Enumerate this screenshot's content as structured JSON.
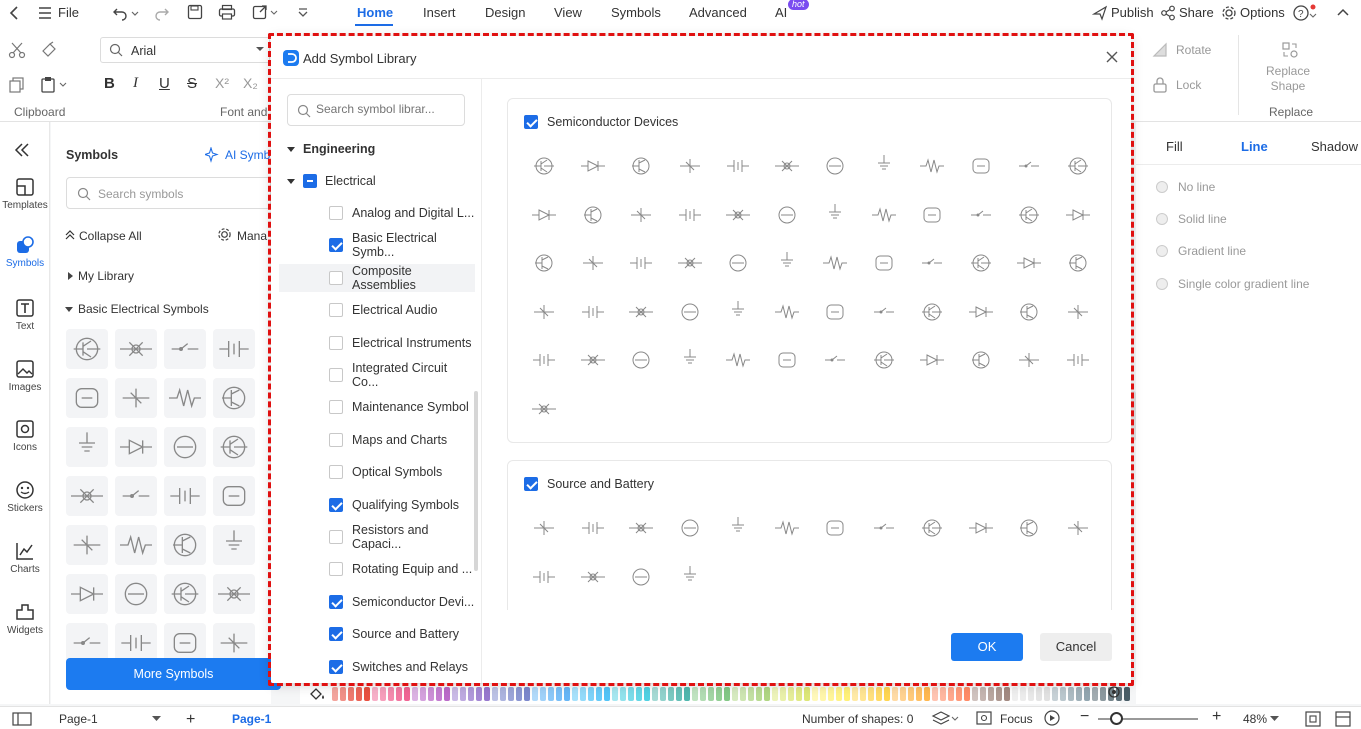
{
  "menubar": {
    "file": "File",
    "tabs": [
      "Home",
      "Insert",
      "Design",
      "View",
      "Symbols",
      "Advanced",
      "AI"
    ],
    "active_tab": "Home",
    "ai_badge": "hot",
    "publish": "Publish",
    "share": "Share",
    "options": "Options"
  },
  "ribbon": {
    "font_name": "Arial",
    "clipboard_label": "Clipboard",
    "font_label": "Font and",
    "rotate": "Rotate",
    "lock": "Lock",
    "replace_shape": "Replace Shape",
    "replace_label": "Replace"
  },
  "left_nav": {
    "items": [
      "Templates",
      "Symbols",
      "Text",
      "Images",
      "Icons",
      "Stickers",
      "Charts",
      "Widgets"
    ],
    "active": "Symbols"
  },
  "symbols_panel": {
    "title": "Symbols",
    "ai_symbols": "AI Symb",
    "search_placeholder": "Search symbols",
    "collapse_all": "Collapse All",
    "manage": "Mana",
    "my_library": "My Library",
    "basic_group": "Basic Electrical Symbols",
    "more_symbols": "More Symbols"
  },
  "right_panel": {
    "tabs": [
      "Fill",
      "Line",
      "Shadow"
    ],
    "active_tab": "Line",
    "options": [
      "No line",
      "Solid line",
      "Gradient line",
      "Single color gradient line"
    ]
  },
  "dialog": {
    "title": "Add Symbol Library",
    "search_placeholder": "Search symbol librar...",
    "tree": {
      "root": "Engineering",
      "group": "Electrical",
      "items": [
        {
          "label": "Analog and Digital L...",
          "checked": false
        },
        {
          "label": "Basic Electrical Symb...",
          "checked": true
        },
        {
          "label": "Composite Assemblies",
          "checked": false
        },
        {
          "label": "Electrical Audio",
          "checked": false
        },
        {
          "label": "Electrical Instruments",
          "checked": false
        },
        {
          "label": "Integrated Circuit Co...",
          "checked": false
        },
        {
          "label": "Maintenance Symbol",
          "checked": false
        },
        {
          "label": "Maps and Charts",
          "checked": false
        },
        {
          "label": "Optical Symbols",
          "checked": false
        },
        {
          "label": "Qualifying Symbols",
          "checked": true
        },
        {
          "label": "Resistors and Capaci...",
          "checked": false
        },
        {
          "label": "Rotating Equip and ...",
          "checked": false
        },
        {
          "label": "Semiconductor Devi...",
          "checked": true
        },
        {
          "label": "Source and Battery",
          "checked": true
        },
        {
          "label": "Switches and Relays",
          "checked": true
        }
      ]
    },
    "sections": [
      {
        "title": "Semiconductor Devices",
        "checked": true,
        "count": 61
      },
      {
        "title": "Source and Battery",
        "checked": true,
        "count": 16
      }
    ],
    "ok": "OK",
    "cancel": "Cancel"
  },
  "status": {
    "page_selector": "Page-1",
    "page_tab": "Page-1",
    "shapes": "Number of shapes: 0",
    "focus": "Focus",
    "zoom": "48%"
  },
  "colors": {
    "accent": "#1c6ce6",
    "dash": "#e01010",
    "palette": [
      "#e84c3d",
      "#f06292",
      "#ba68c8",
      "#9575cd",
      "#7986cb",
      "#64b5f6",
      "#4fc3f7",
      "#4dd0e1",
      "#4db6ac",
      "#81c784",
      "#aed581",
      "#dce775",
      "#fff176",
      "#ffd54f",
      "#ffb74d",
      "#ff8a65",
      "#a1887f",
      "#e0e0e0",
      "#90a4ae",
      "#455a64"
    ]
  }
}
